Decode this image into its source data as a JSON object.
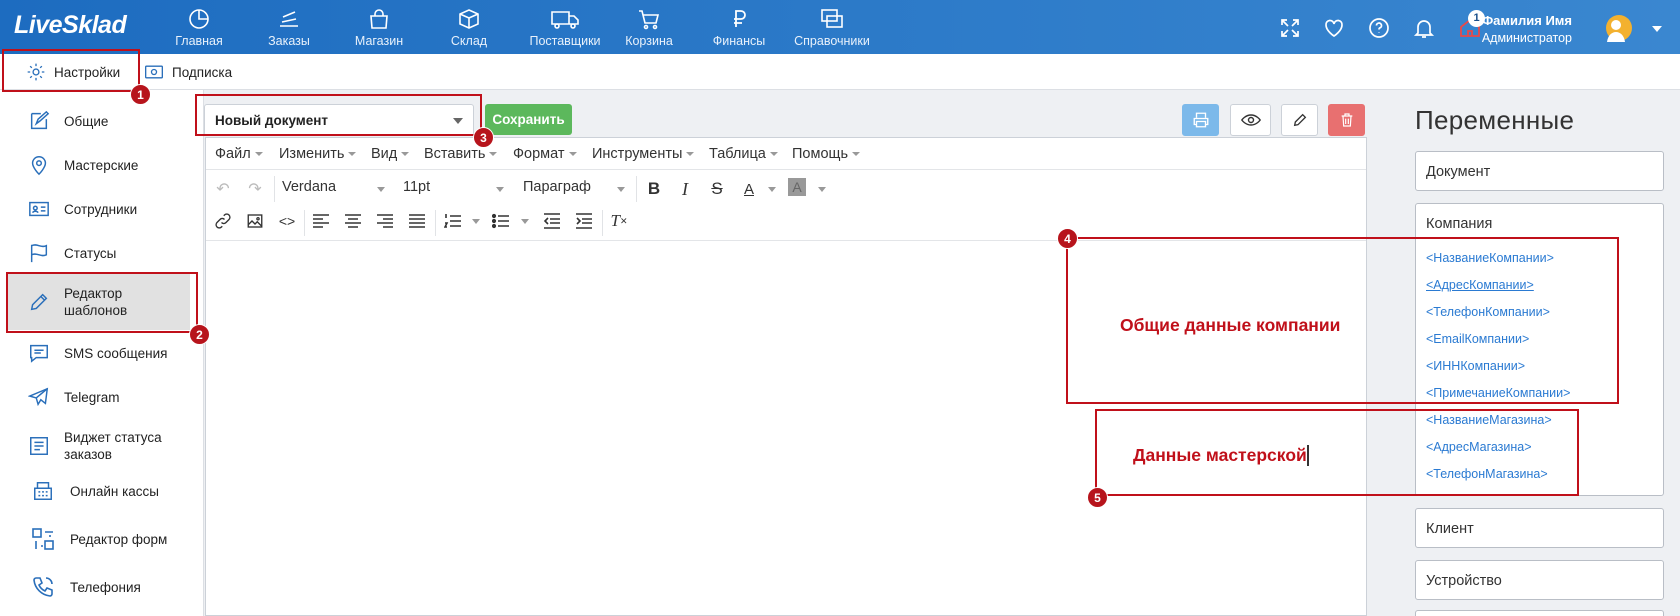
{
  "app": {
    "logo": "LiveSklad"
  },
  "nav": [
    {
      "label": "Главная",
      "icon": "pie-chart-icon"
    },
    {
      "label": "Заказы",
      "icon": "stack-icon"
    },
    {
      "label": "Магазин",
      "icon": "bag-icon"
    },
    {
      "label": "Склад",
      "icon": "box-icon"
    },
    {
      "label": "Поставщики",
      "icon": "truck-icon"
    },
    {
      "label": "Корзина",
      "icon": "cart-icon"
    },
    {
      "label": "Финансы",
      "icon": "ruble-icon"
    },
    {
      "label": "Справочники",
      "icon": "cards-icon"
    }
  ],
  "topbar": {
    "notifications_count": "1",
    "user_name": "Фамилия Имя",
    "user_role": "Администратор"
  },
  "subtabs": [
    {
      "label": "Настройки",
      "icon": "gear-icon"
    },
    {
      "label": "Подписка",
      "icon": "money-icon"
    }
  ],
  "sidebar": {
    "items": [
      {
        "label": "Общие",
        "icon": "edit-icon"
      },
      {
        "label": "Мастерские",
        "icon": "location-icon"
      },
      {
        "label": "Сотрудники",
        "icon": "id-card-icon"
      },
      {
        "label": "Статусы",
        "icon": "flag-icon"
      },
      {
        "label": "Редактор шаблонов",
        "icon": "pencil-icon",
        "active": true
      },
      {
        "label": "SMS сообщения",
        "icon": "chat-icon"
      },
      {
        "label": "Telegram",
        "icon": "telegram-icon"
      },
      {
        "label": "Виджет статуса заказов",
        "icon": "widget-icon"
      },
      {
        "label": "Онлайн кассы",
        "icon": "cash-register-icon"
      },
      {
        "label": "Редактор форм",
        "icon": "form-editor-icon"
      },
      {
        "label": "Телефония",
        "icon": "phone-icon"
      }
    ]
  },
  "editor": {
    "document_select": "Новый документ",
    "save_label": "Сохранить",
    "menu": [
      "Файл",
      "Изменить",
      "Вид",
      "Вставить",
      "Формат",
      "Инструменты",
      "Таблица",
      "Помощь"
    ],
    "font_family": "Verdana",
    "font_size": "11pt",
    "block_format": "Параграф"
  },
  "annotations": [
    {
      "num": "1"
    },
    {
      "num": "2"
    },
    {
      "num": "3"
    },
    {
      "num": "4",
      "text": "Общие данные компании"
    },
    {
      "num": "5",
      "text": "Данные мастерской"
    }
  ],
  "variables": {
    "title": "Переменные",
    "document_label": "Документ",
    "company_label": "Компания",
    "company_items": [
      "<НазваниеКомпании>",
      "<АдресКомпании>",
      "<ТелефонКомпании>",
      "<EmailКомпании>",
      "<ИННКомпании>",
      "<ПримечаниеКомпании>",
      "<НазваниеМагазина>",
      "<АдресМагазина>",
      "<ТелефонМагазина>"
    ],
    "client_label": "Клиент",
    "device_label": "Устройство"
  },
  "colors": {
    "topbar": "#2a7acb",
    "accent_red": "#c0101a",
    "save_green": "#5cb85c",
    "link_blue": "#2a7ad2",
    "print_blue": "#7cb9ea",
    "delete_red": "#e87070"
  }
}
